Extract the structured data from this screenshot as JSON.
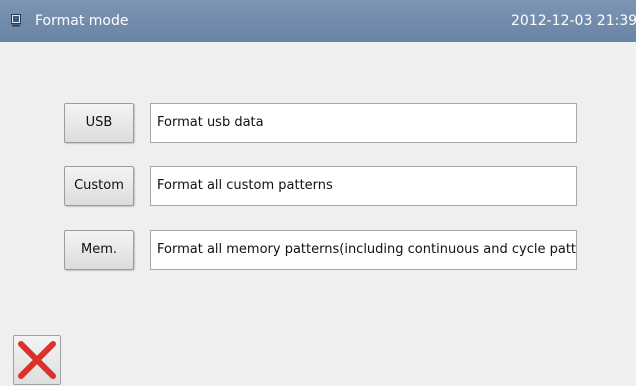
{
  "titlebar": {
    "icon": "screen-icon",
    "title": "Format mode",
    "datetime": "2012-12-03  21:39"
  },
  "rows": [
    {
      "button_label": "USB",
      "description": "Format usb data"
    },
    {
      "button_label": "Custom",
      "description": "Format all custom patterns"
    },
    {
      "button_label": "Mem.",
      "description": "Format all memory patterns(including continuous and cycle patterns)"
    }
  ],
  "footer": {
    "close_icon": "close-icon",
    "close_color": "#d9322a"
  }
}
